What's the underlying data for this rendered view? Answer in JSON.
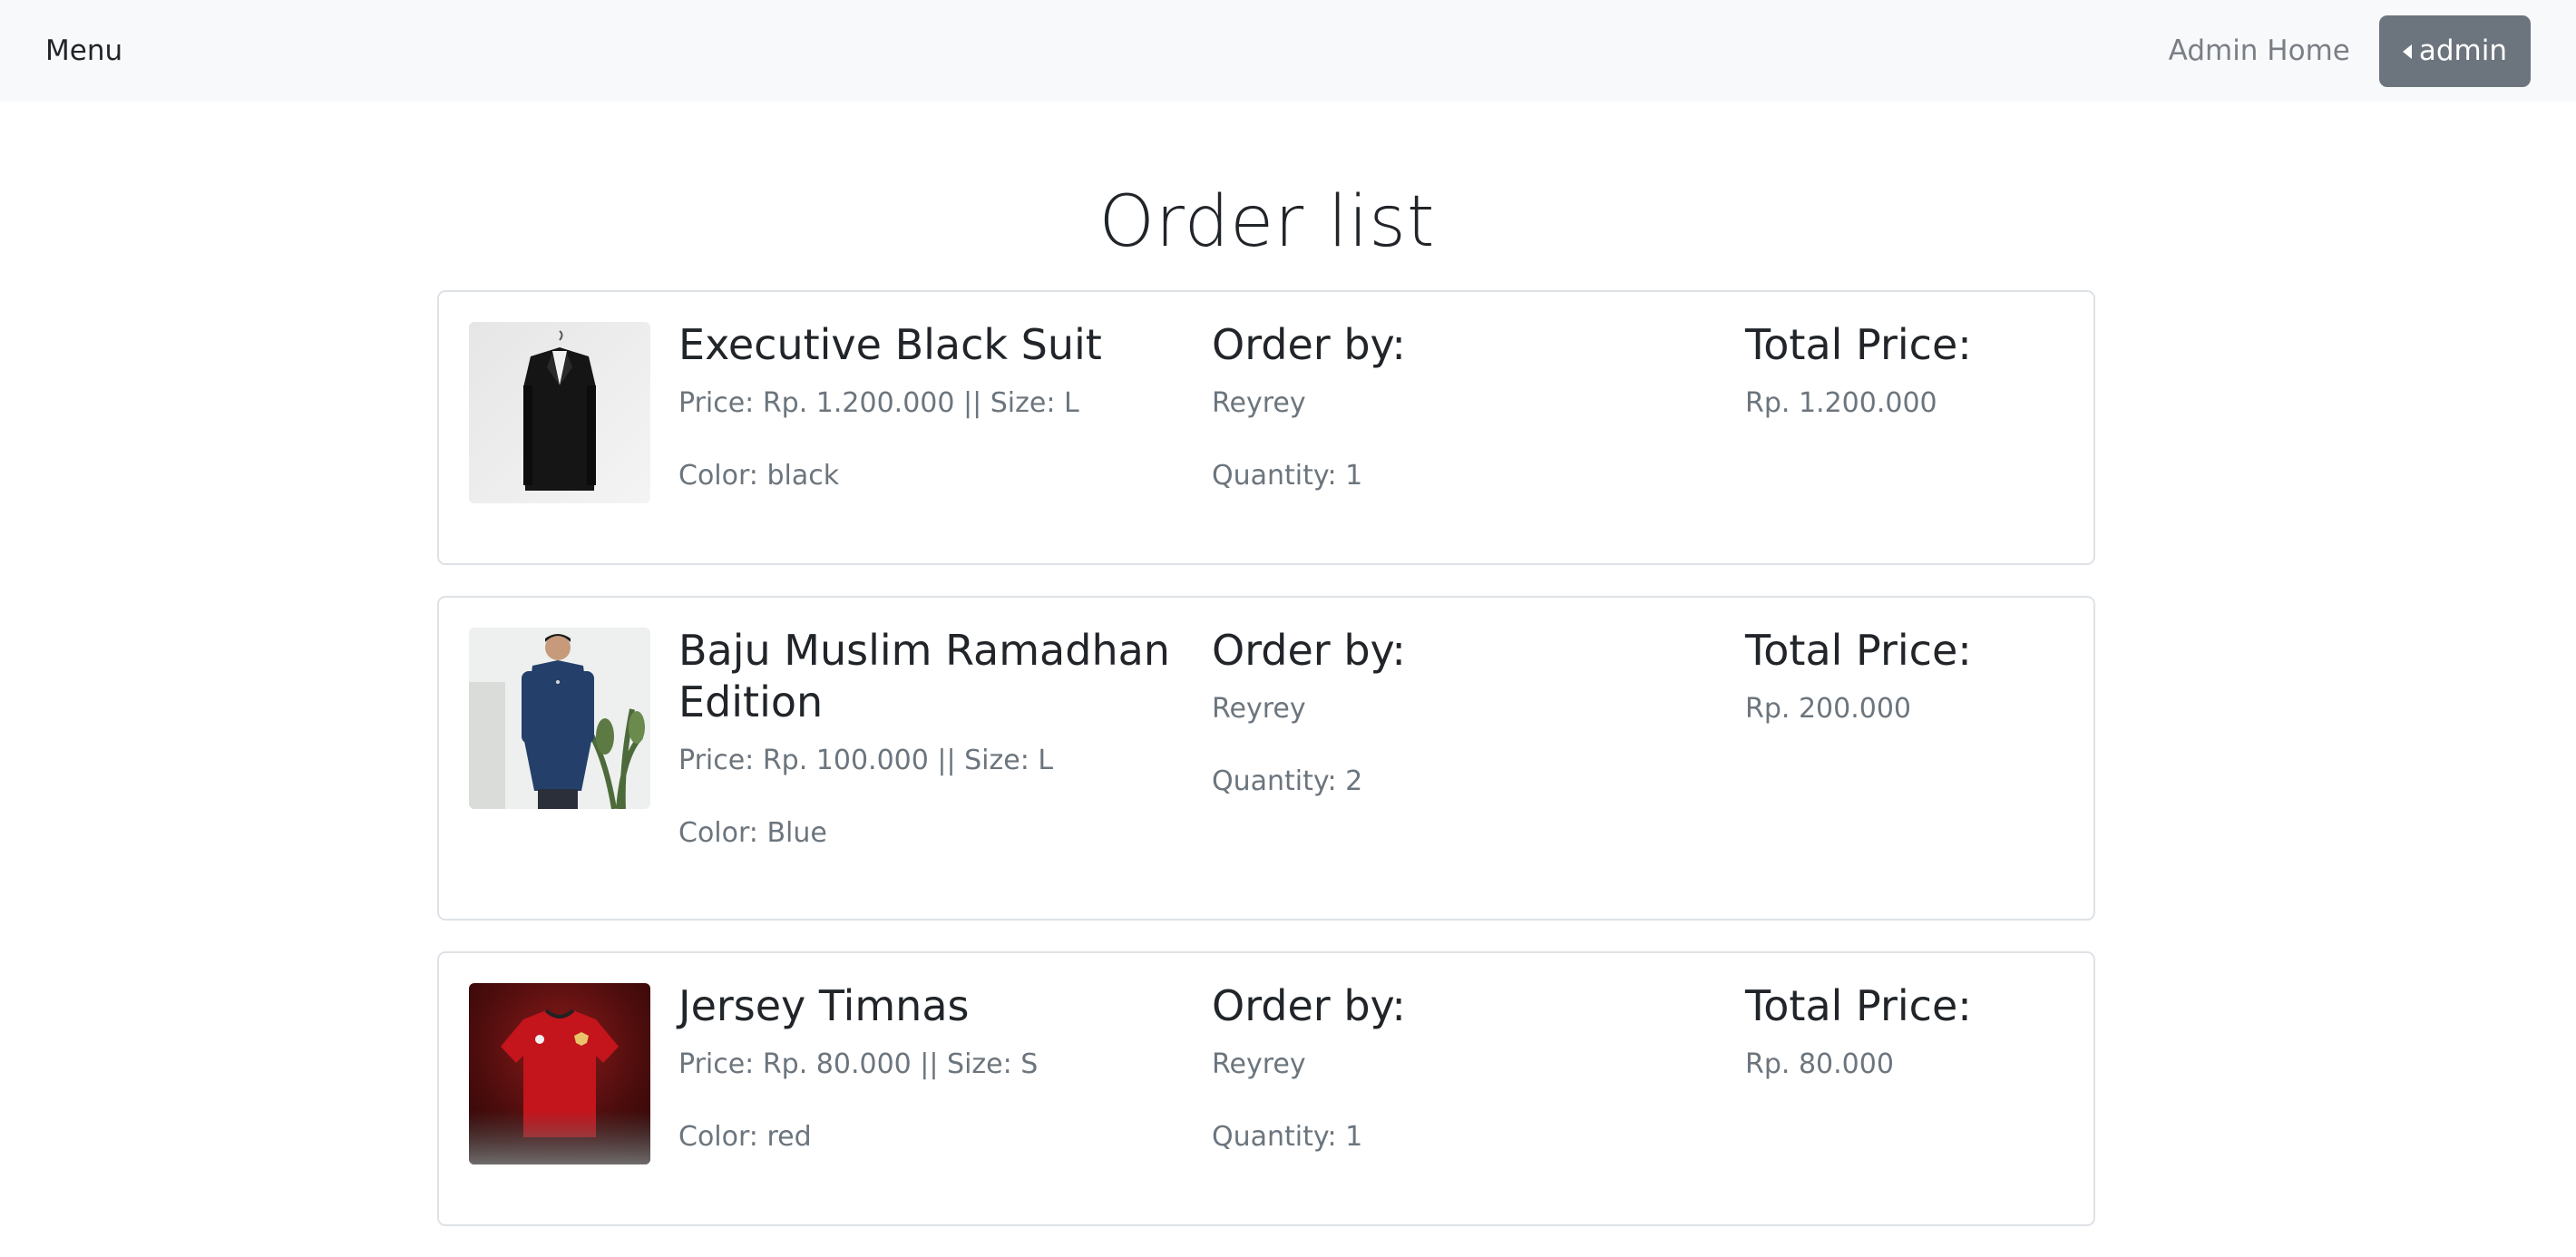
{
  "navbar": {
    "brand": "Menu",
    "admin_home": "Admin Home",
    "admin_button": "admin"
  },
  "page": {
    "title": "Order list"
  },
  "labels": {
    "order_by": "Order by:",
    "total_price": "Total Price:"
  },
  "orders": [
    {
      "product_name": "Executive Black Suit",
      "price_size": "Price: Rp. 1.200.000 || Size: L",
      "color": "Color: black",
      "customer": "Reyrey",
      "quantity": "Quantity: 1",
      "total": "Rp. 1.200.000",
      "image": "black-suit-on-hanger"
    },
    {
      "product_name": "Baju Muslim Ramadhan Edition",
      "price_size": "Price: Rp. 100.000 || Size: L",
      "color": "Color: Blue",
      "customer": "Reyrey",
      "quantity": "Quantity: 2",
      "total": "Rp. 200.000",
      "image": "man-in-blue-muslim-shirt"
    },
    {
      "product_name": "Jersey Timnas",
      "price_size": "Price: Rp. 80.000 || Size: S",
      "color": "Color: red",
      "customer": "Reyrey",
      "quantity": "Quantity: 1",
      "total": "Rp. 80.000",
      "image": "red-national-team-jersey"
    }
  ],
  "colors": {
    "navbar_bg": "#f8f9fa",
    "admin_button_bg": "#6c757d",
    "muted_text": "#6c757d",
    "card_border": "#dee2e6"
  }
}
